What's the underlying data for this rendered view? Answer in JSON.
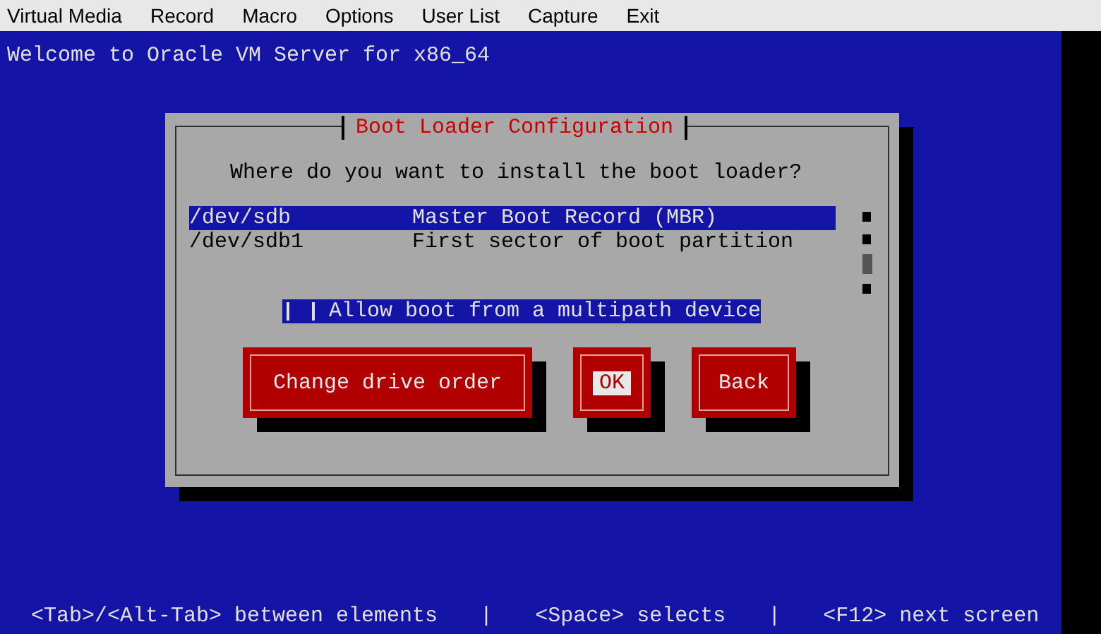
{
  "menu_bar": {
    "items": [
      "Virtual Media",
      "Record",
      "Macro",
      "Options",
      "User List",
      "Capture",
      "Exit"
    ]
  },
  "console": {
    "banner": "Welcome to Oracle VM Server for x86_64"
  },
  "dialog": {
    "title": "Boot Loader Configuration",
    "prompt": "Where do you want to install the boot loader?",
    "options": [
      {
        "device": "/dev/sdb",
        "description": "Master Boot Record (MBR)",
        "selected": true
      },
      {
        "device": "/dev/sdb1",
        "description": "First sector of boot partition",
        "selected": false
      }
    ],
    "checkbox": {
      "label": "Allow boot from a multipath device",
      "checked": false,
      "focused": true
    },
    "buttons": [
      {
        "label": "Change drive order",
        "focused": false
      },
      {
        "label": "OK",
        "focused": true
      },
      {
        "label": "Back",
        "focused": false
      }
    ]
  },
  "status_bar": {
    "hints": [
      "<Tab>/<Alt-Tab> between elements",
      "<Space> selects",
      "<F12> next screen"
    ],
    "separator": "|"
  }
}
